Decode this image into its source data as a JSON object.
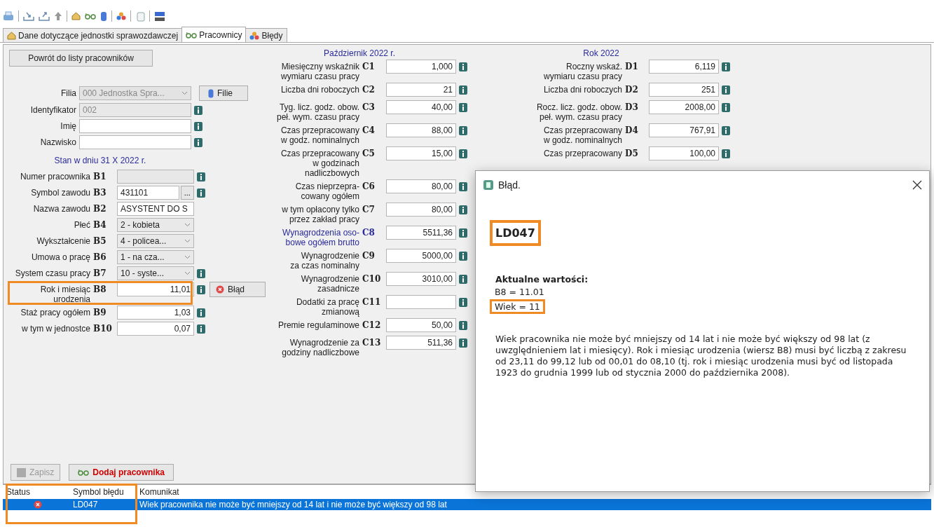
{
  "tabs": [
    {
      "label": "Dane dotyczące jednostki sprawozdawczej",
      "kind": "house",
      "selected": false
    },
    {
      "label": "Pracownicy",
      "kind": "glasses",
      "selected": true
    },
    {
      "label": "Błędy",
      "kind": "circles",
      "selected": false
    }
  ],
  "back_button": "Powrót do listy pracowników",
  "branch": {
    "label": "Filia",
    "value": "000 Jednostka Spra...",
    "button": "Filie"
  },
  "identity_fields": [
    {
      "label": "Identyfikator",
      "value": "002",
      "disabled": true
    },
    {
      "label": "Imię",
      "disabled": false
    },
    {
      "label": "Nazwisko",
      "disabled": false
    }
  ],
  "section_b_title": "Stan w dniu 31 X 2022 r.",
  "rows_b": [
    {
      "label": [
        "Numer pracownika"
      ],
      "code": "B1",
      "kind": "text",
      "disabled": true,
      "info": true,
      "highlighted": false
    },
    {
      "label": [
        "Symbol zawodu"
      ],
      "code": "B3",
      "kind": "lookup",
      "value": "431101",
      "button": "...",
      "disabled": false,
      "info": true,
      "highlighted": false
    },
    {
      "label": [
        "Nazwa zawodu"
      ],
      "code": "B2",
      "kind": "text",
      "value": "ASYSTENT DO S",
      "disabled": false,
      "info": false,
      "highlighted": false
    },
    {
      "label": [
        "Płeć"
      ],
      "code": "B4",
      "kind": "select",
      "value": "2 - kobieta",
      "disabled": false,
      "info": false,
      "highlighted": false
    },
    {
      "label": [
        "Wykształcenie"
      ],
      "code": "B5",
      "kind": "select",
      "value": "4 - policea...",
      "disabled": false,
      "info": false,
      "highlighted": false
    },
    {
      "label": [
        "Umowa o pracę"
      ],
      "code": "B6",
      "kind": "select",
      "value": "1 - na cza...",
      "disabled": false,
      "info": false,
      "highlighted": false
    },
    {
      "label": [
        "System czasu pracy"
      ],
      "code": "B7",
      "kind": "select",
      "value": "10 - syste...",
      "disabled": false,
      "info": true,
      "highlighted": false
    },
    {
      "label": [
        "Rok i miesiąc",
        "urodzenia"
      ],
      "code": "B8",
      "kind": "number",
      "value": "11,01",
      "disabled": false,
      "info": true,
      "highlighted": true,
      "error_button": "Błąd"
    },
    {
      "label": [
        "Staż pracy ogółem"
      ],
      "code": "B9",
      "kind": "number",
      "value": "1,03",
      "disabled": false,
      "info": true,
      "highlighted": false
    },
    {
      "label": [
        "w tym w jednostce"
      ],
      "code": "B10",
      "kind": "number",
      "value": "0,07",
      "disabled": false,
      "info": true,
      "highlighted": false
    }
  ],
  "section_c_title": "Październik 2022 r.",
  "rows_c": [
    {
      "label": [
        "Miesięczny wskaźnik",
        "wymiaru czasu pracy"
      ],
      "code": "C1",
      "value": "1,000",
      "emphasized": false
    },
    {
      "label": [
        "Liczba dni roboczych"
      ],
      "code": "C2",
      "value": "21",
      "emphasized": false
    },
    {
      "label": [
        "Tyg. licz. godz. obow.",
        "peł. wym. czasu pracy"
      ],
      "code": "C3",
      "value": "40,00",
      "emphasized": false
    },
    {
      "label": [
        "Czas przepracowany",
        "w godz. nominalnych"
      ],
      "code": "C4",
      "value": "88,00",
      "emphasized": false
    },
    {
      "label": [
        "Czas przepracowany",
        "w godzinach",
        "nadliczbowych"
      ],
      "code": "C5",
      "value": "15,00",
      "emphasized": false
    },
    {
      "label": [
        "Czas nieprzepra-",
        "cowany ogółem"
      ],
      "code": "C6",
      "value": "80,00",
      "emphasized": false
    },
    {
      "label": [
        "w tym opłacony tylko",
        "przez zakład pracy"
      ],
      "code": "C7",
      "value": "80,00",
      "emphasized": false
    },
    {
      "label": [
        "Wynagrodzenia oso-",
        "bowe ogółem brutto"
      ],
      "code": "C8",
      "value": "5511,36",
      "emphasized": true
    },
    {
      "label": [
        "Wynagrodzenie",
        "za czas nominalny"
      ],
      "code": "C9",
      "value": "5000,00",
      "emphasized": false
    },
    {
      "label": [
        "Wynagrodzenie",
        "zasadnicze"
      ],
      "code": "C10",
      "value": "3010,00",
      "emphasized": false
    },
    {
      "label": [
        "Dodatki za pracę",
        "zmianową"
      ],
      "code": "C11",
      "emphasized": false
    },
    {
      "label": [
        "Premie regulaminowe"
      ],
      "code": "C12",
      "value": "50,00",
      "emphasized": false
    },
    {
      "label": [
        "Wynagrodzenie za",
        "godziny nadliczbowe"
      ],
      "code": "C13",
      "value": "511,36",
      "emphasized": false
    }
  ],
  "section_d_title": "Rok 2022",
  "rows_d": [
    {
      "label": [
        "Roczny wskaź.",
        "wymiaru czasu pracy"
      ],
      "code": "D1",
      "value": "6,119"
    },
    {
      "label": [
        "Liczba dni roboczych"
      ],
      "code": "D2",
      "value": "251"
    },
    {
      "label": [
        "Rocz. licz. godz. obow.",
        "peł. wym. czasu pracy"
      ],
      "code": "D3",
      "value": "2008,00"
    },
    {
      "label": [
        "Czas przepracowany",
        "w godz. nominalnych"
      ],
      "code": "D4",
      "value": "767,91"
    },
    {
      "label": [
        "Czas przepracowany"
      ],
      "code": "D5",
      "value": "100,00"
    }
  ],
  "save_button": {
    "label": "Zapisz",
    "disabled": true
  },
  "add_button": "Dodaj pracownika",
  "errors_table": {
    "columns": [
      "Status",
      "Symbol błędu",
      "Komunikat"
    ],
    "highlighted": true,
    "rows": [
      {
        "kind": "error",
        "symbol": "LD047",
        "message": "Wiek pracownika nie może być mniejszy od 14 lat i nie może być większy od 98 lat",
        "selected": true
      }
    ]
  },
  "dialog": {
    "title": "Błąd.",
    "code": "LD047",
    "code_highlighted": true,
    "values_heading": "Aktualne wartości:",
    "values": [
      {
        "text": "B8 = 11.01",
        "highlighted": false
      },
      {
        "text": "Wiek = 11",
        "highlighted": true
      }
    ],
    "description": "Wiek pracownika nie może być mniejszy od 14 lat i nie może być większy od 98 lat (z uwzględnieniem lat i miesięcy). Rok i miesiąc urodzenia (wiersz B8) musi być liczbą z zakresu od 23,11 do 99,12 lub od 00,01 do 08,10 (tj. rok i miesiąc urodzenia musi być od listopada 1923 do grudnia 1999 lub od stycznia 2000 do października 2008)."
  }
}
